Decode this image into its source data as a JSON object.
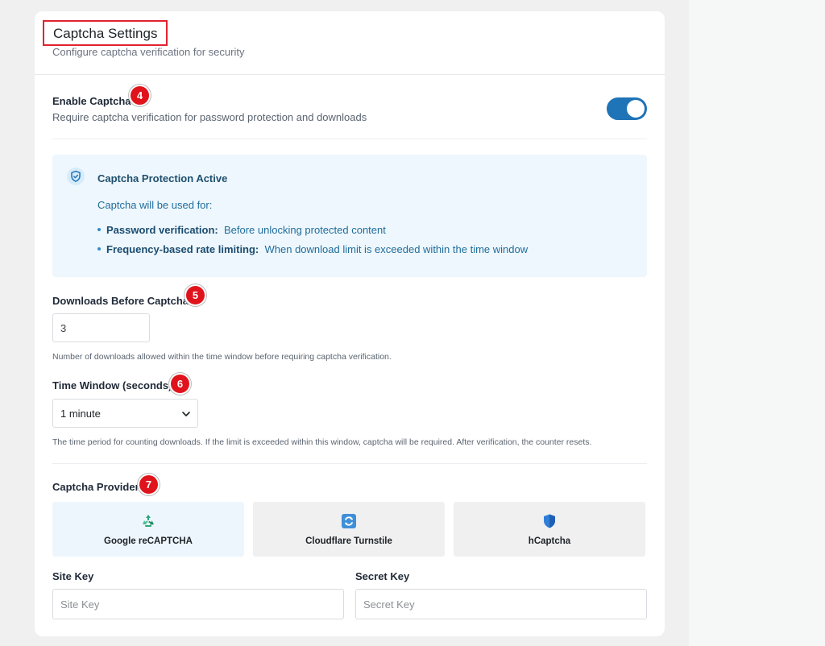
{
  "header": {
    "title": "Captcha Settings",
    "subtitle": "Configure captcha verification for security"
  },
  "enable_captcha": {
    "label": "Enable Captcha",
    "badge": "4",
    "description": "Require captcha verification for password protection and downloads",
    "enabled": true
  },
  "protection_notice": {
    "icon": "shield-check-icon",
    "title": "Captcha Protection Active",
    "intro": "Captcha will be used for:",
    "items": [
      {
        "term": "Password verification:",
        "text": "Before unlocking protected content"
      },
      {
        "term": "Frequency-based rate limiting:",
        "text": "When download limit is exceeded within the time window"
      }
    ]
  },
  "downloads_before": {
    "label": "Downloads Before Captcha",
    "badge": "5",
    "value": "3",
    "help": "Number of downloads allowed within the time window before requiring captcha verification."
  },
  "time_window": {
    "label": "Time Window (seconds)",
    "badge": "6",
    "selected": "1 minute",
    "help": "The time period for counting downloads. If the limit is exceeded within this window, captcha will be required. After verification, the counter resets."
  },
  "provider": {
    "label": "Captcha Provider",
    "badge": "7",
    "options": [
      {
        "name": "Google reCAPTCHA",
        "icon": "recaptcha-icon",
        "selected": true
      },
      {
        "name": "Cloudflare Turnstile",
        "icon": "turnstile-icon",
        "selected": false
      },
      {
        "name": "hCaptcha",
        "icon": "hcaptcha-icon",
        "selected": false
      }
    ]
  },
  "keys": {
    "site_key_label": "Site Key",
    "site_key_placeholder": "Site Key",
    "secret_key_label": "Secret Key",
    "secret_key_placeholder": "Secret Key"
  },
  "colors": {
    "accent": "#1f73b7",
    "highlight_border": "#e1232f",
    "badge": "#e0131c",
    "info_bg": "#eef7fd"
  }
}
